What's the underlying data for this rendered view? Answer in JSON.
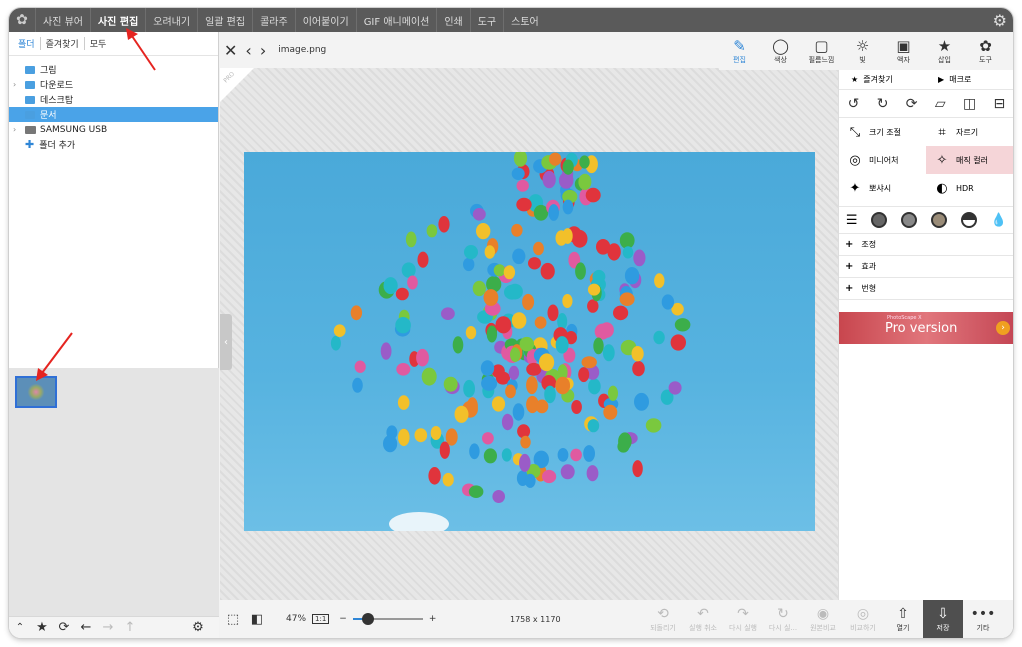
{
  "menu": {
    "items": [
      "사진 뷰어",
      "사진 편집",
      "오려내기",
      "일괄 편집",
      "콜라주",
      "이어붙이기",
      "GIF 애니메이션",
      "인쇄",
      "도구",
      "스토어"
    ],
    "active_index": 1
  },
  "left": {
    "tabs": [
      "폴더",
      "즐겨찾기",
      "모두"
    ],
    "tree": [
      {
        "label": "그림",
        "arrow": "",
        "type": "folder"
      },
      {
        "label": "다운로드",
        "arrow": "›",
        "type": "folder"
      },
      {
        "label": "데스크탑",
        "arrow": "",
        "type": "folder"
      },
      {
        "label": "문서",
        "arrow": "",
        "type": "folder",
        "selected": true
      },
      {
        "label": "SAMSUNG USB",
        "arrow": "›",
        "type": "usb"
      },
      {
        "label": "폴더 추가",
        "arrow": "",
        "type": "add"
      }
    ]
  },
  "center": {
    "filename": "image.png",
    "zoom": "47%",
    "one_to_one": "1:1",
    "zoom_value": 0.22,
    "dimensions": "1758 x 1170",
    "pro_tag": "PRO"
  },
  "right": {
    "tools": [
      {
        "label": "편집",
        "icon": "edit-icon",
        "glyph": "✎",
        "active": true
      },
      {
        "label": "색상",
        "icon": "color-icon",
        "glyph": "◯"
      },
      {
        "label": "필름느낌",
        "icon": "film-icon",
        "glyph": "▢"
      },
      {
        "label": "빛",
        "icon": "light-icon",
        "glyph": "☼"
      },
      {
        "label": "액자",
        "icon": "frame-icon",
        "glyph": "▣"
      },
      {
        "label": "삽입",
        "icon": "insert-icon",
        "glyph": "★"
      },
      {
        "label": "도구",
        "icon": "tools-icon",
        "glyph": "✿"
      }
    ],
    "favorites": "즐겨찾기",
    "macro": "매크로",
    "grid": [
      {
        "label": "크기 조절",
        "icon": "resize-icon",
        "glyph": "⤡"
      },
      {
        "label": "자르기",
        "icon": "crop-icon",
        "glyph": "⌗"
      },
      {
        "label": "미니어처",
        "icon": "miniature-icon",
        "glyph": "◎"
      },
      {
        "label": "매직 컬러",
        "icon": "magic-wand-icon",
        "glyph": "✧",
        "highlight": true
      },
      {
        "label": "뽀샤시",
        "icon": "bloom-icon",
        "glyph": "✦"
      },
      {
        "label": "HDR",
        "icon": "hdr-icon",
        "glyph": "◐"
      }
    ],
    "accordion": [
      "조정",
      "효과",
      "번형"
    ],
    "banner_small": "PhotoScape X",
    "banner_big": "Pro version"
  },
  "bottom_actions": [
    {
      "label": "되돌리기",
      "icon": "revert-icon",
      "glyph": "⟲",
      "enabled": false
    },
    {
      "label": "실행 취소",
      "icon": "undo-icon",
      "glyph": "↶",
      "enabled": false
    },
    {
      "label": "다시 실행",
      "icon": "redo-icon",
      "glyph": "↷",
      "enabled": false
    },
    {
      "label": "다시 실...",
      "icon": "redo-all-icon",
      "glyph": "↻",
      "enabled": false
    },
    {
      "label": "원본비교",
      "icon": "compare-icon",
      "glyph": "◉",
      "enabled": false
    },
    {
      "label": "비교하기",
      "icon": "compare2-icon",
      "glyph": "◎",
      "enabled": false
    },
    {
      "label": "열기",
      "icon": "share-icon",
      "glyph": "⇧",
      "enabled": true
    },
    {
      "label": "저장",
      "icon": "save-icon",
      "glyph": "⇩",
      "enabled": true,
      "save": true
    },
    {
      "label": "기타",
      "icon": "more-icon",
      "glyph": "•••",
      "enabled": true
    }
  ],
  "colors": {
    "accent": "#2f86d6",
    "menubar": "#5a5a5a",
    "selection": "#4aa3e8",
    "banner": "#c8464e",
    "annotation": "#e52420"
  }
}
